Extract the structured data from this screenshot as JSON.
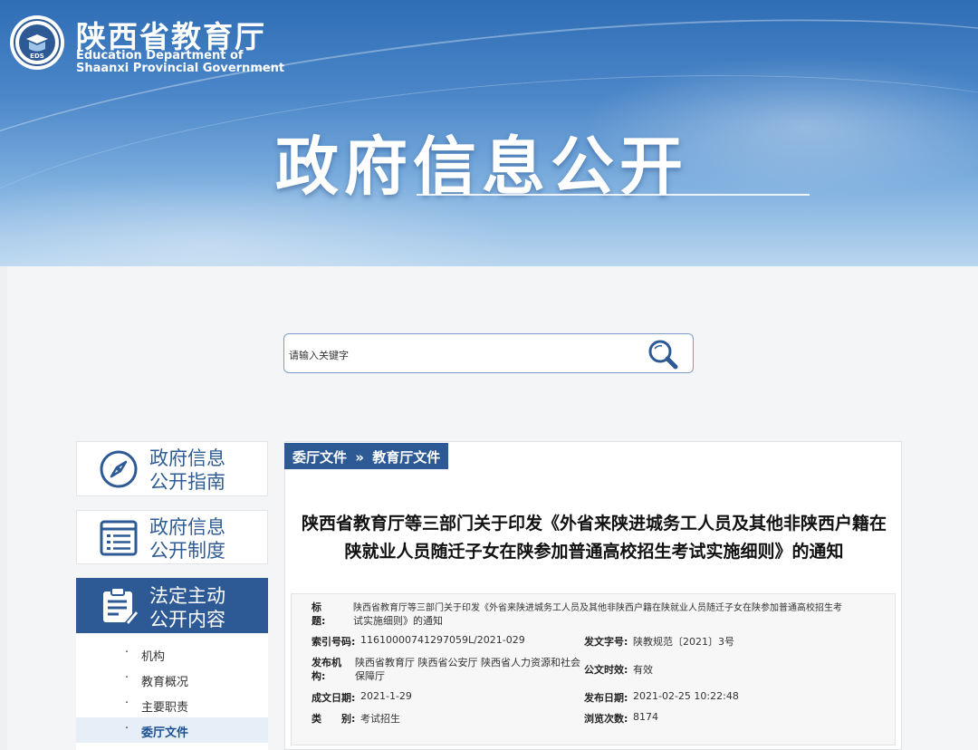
{
  "header": {
    "org_cn": "陕西省教育厅",
    "org_en_line1": "Education Department of",
    "org_en_line2": "Shaanxi Provincial Government",
    "banner_title": "政府信息公开",
    "emblem_text": "EDS"
  },
  "search": {
    "placeholder": "请输入关键字"
  },
  "sidebar": {
    "cards": [
      {
        "line1": "政府信息",
        "line2": "公开指南",
        "icon": "compass-icon"
      },
      {
        "line1": "政府信息",
        "line2": "公开制度",
        "icon": "list-icon"
      },
      {
        "line1": "法定主动",
        "line2": "公开内容",
        "icon": "clipboard-icon"
      }
    ],
    "items": [
      {
        "bullet": "·",
        "label": "机构"
      },
      {
        "bullet": "·",
        "label": "教育概况"
      },
      {
        "bullet": "·",
        "label": "主要职责"
      },
      {
        "bullet": "·",
        "label": "委厅文件"
      }
    ]
  },
  "breadcrumb": {
    "part1": "委厅文件",
    "sep": "»",
    "part2": "教育厅文件"
  },
  "article": {
    "title_line1": "陕西省教育厅等三部门关于印发《外省来陕进城务工人员及其他非陕西户籍在",
    "title_line2": "陕就业人员随迁子女在陕参加普通高校招生考试实施细则》的通知"
  },
  "meta": {
    "title_label_1": "标",
    "title_label_2": "题:",
    "title_value_1": "陕西省教育厅等三部门关于印发《外省来陕进城务工人员及其他非陕西户籍在陕就业人员随迁子女在陕参加普通高校招生考",
    "title_value_2": "试实施细则》的通知",
    "index_label": "索引号码:",
    "index_value": "11610000741297059L/2021-029",
    "doc_no_label": "发文字号:",
    "doc_no_value": "陕教规范〔2021〕3号",
    "issuer_label_1": "发布机",
    "issuer_label_2": "构:",
    "issuer_value_1": "陕西省教育厅 陕西省公安厅 陕西省人力资源和社会",
    "issuer_value_2": "保障厅",
    "validity_label": "公文时效:",
    "validity_value": "有效",
    "created_label": "成文日期:",
    "created_value": "2021-1-29",
    "published_label": "发布日期:",
    "published_value": "2021-02-25 10:22:48",
    "category_label": "类　　别:",
    "category_value": "考试招生",
    "views_label": "浏览次数:",
    "views_value": "8174"
  }
}
